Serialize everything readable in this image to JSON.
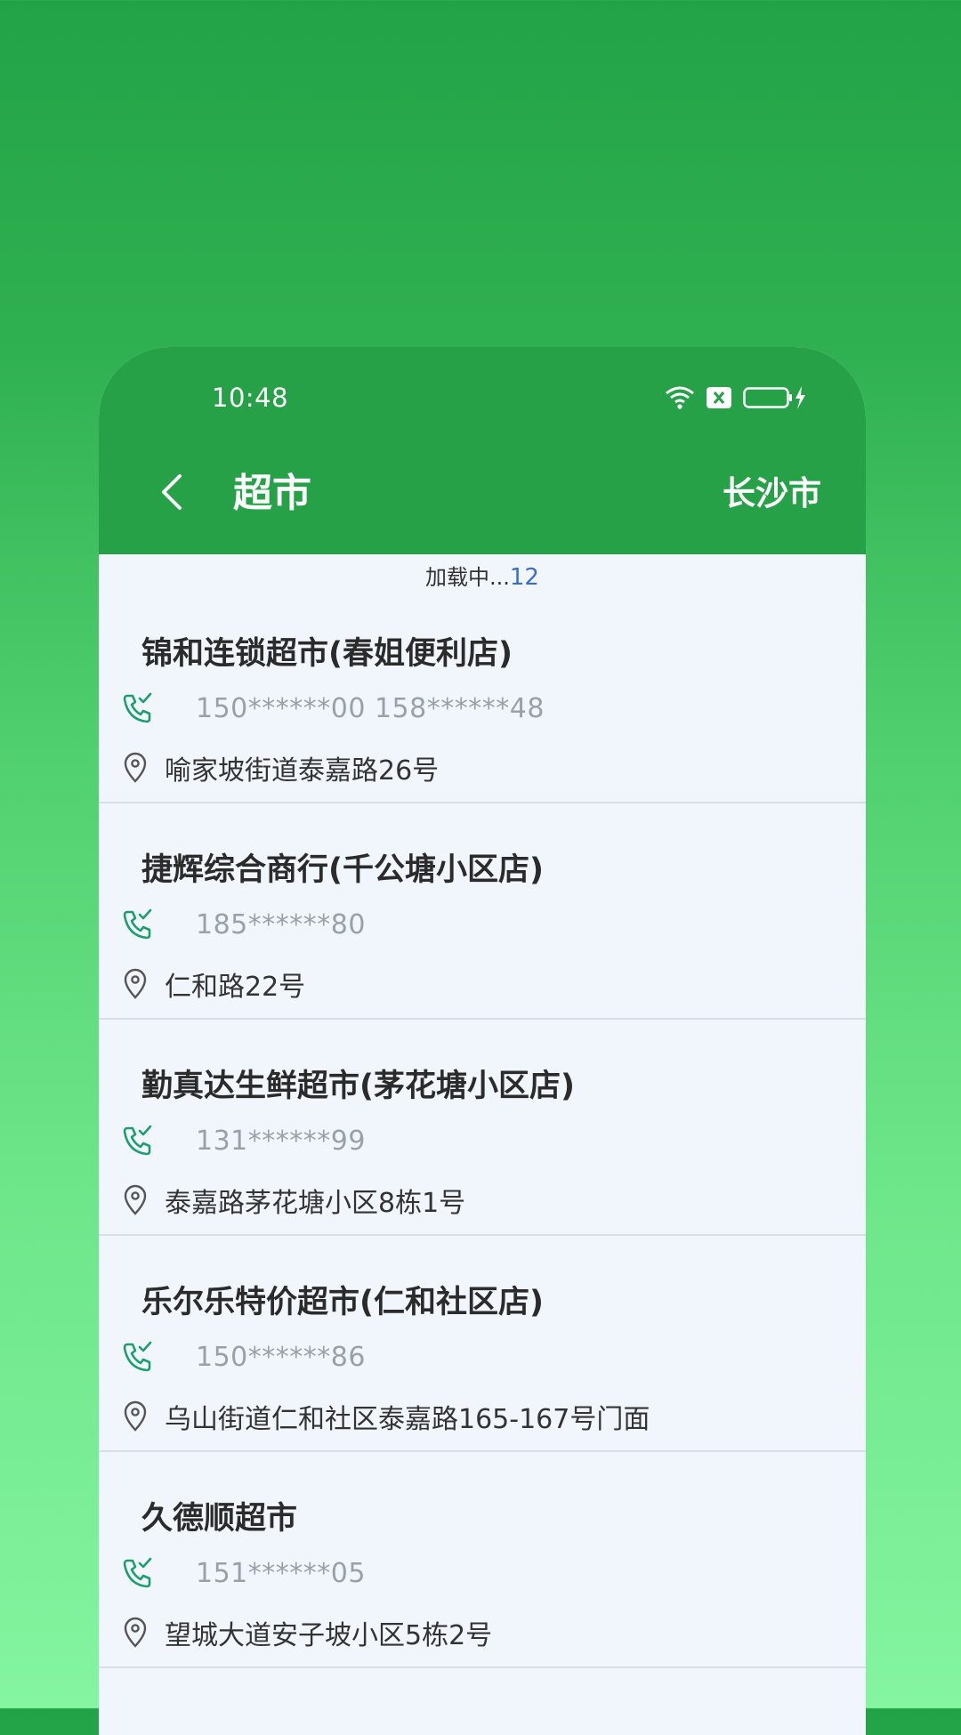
{
  "status_bar": {
    "time": "10:48"
  },
  "header": {
    "title": "超市",
    "city": "长沙市"
  },
  "loading": {
    "text": "加载中...",
    "count": "12"
  },
  "stores": [
    {
      "name": "锦和连锁超市(春姐便利店)",
      "phones": "150******00   158******48",
      "address": "喻家坡街道泰嘉路26号"
    },
    {
      "name": "捷辉综合商行(千公塘小区店)",
      "phones": "185******80",
      "address": "仁和路22号"
    },
    {
      "name": "勤真达生鲜超市(茅花塘小区店)",
      "phones": "131******99",
      "address": "泰嘉路茅花塘小区8栋1号"
    },
    {
      "name": "乐尔乐特价超市(仁和社区店)",
      "phones": "150******86",
      "address": "乌山街道仁和社区泰嘉路165-167号门面"
    },
    {
      "name": "久德顺超市",
      "phones": "151******05",
      "address": "望城大道安子坡小区5栋2号"
    }
  ],
  "icons": {
    "back": "back-arrow-icon",
    "phone": "phone-call-icon",
    "location": "location-pin-icon",
    "wifi": "wifi-icon",
    "sim": "sim-disabled-icon",
    "battery": "battery-charging-icon"
  },
  "colors": {
    "primary": "#26a148",
    "phone_icon": "#1e9e6a",
    "background": "#f1f6fd"
  }
}
